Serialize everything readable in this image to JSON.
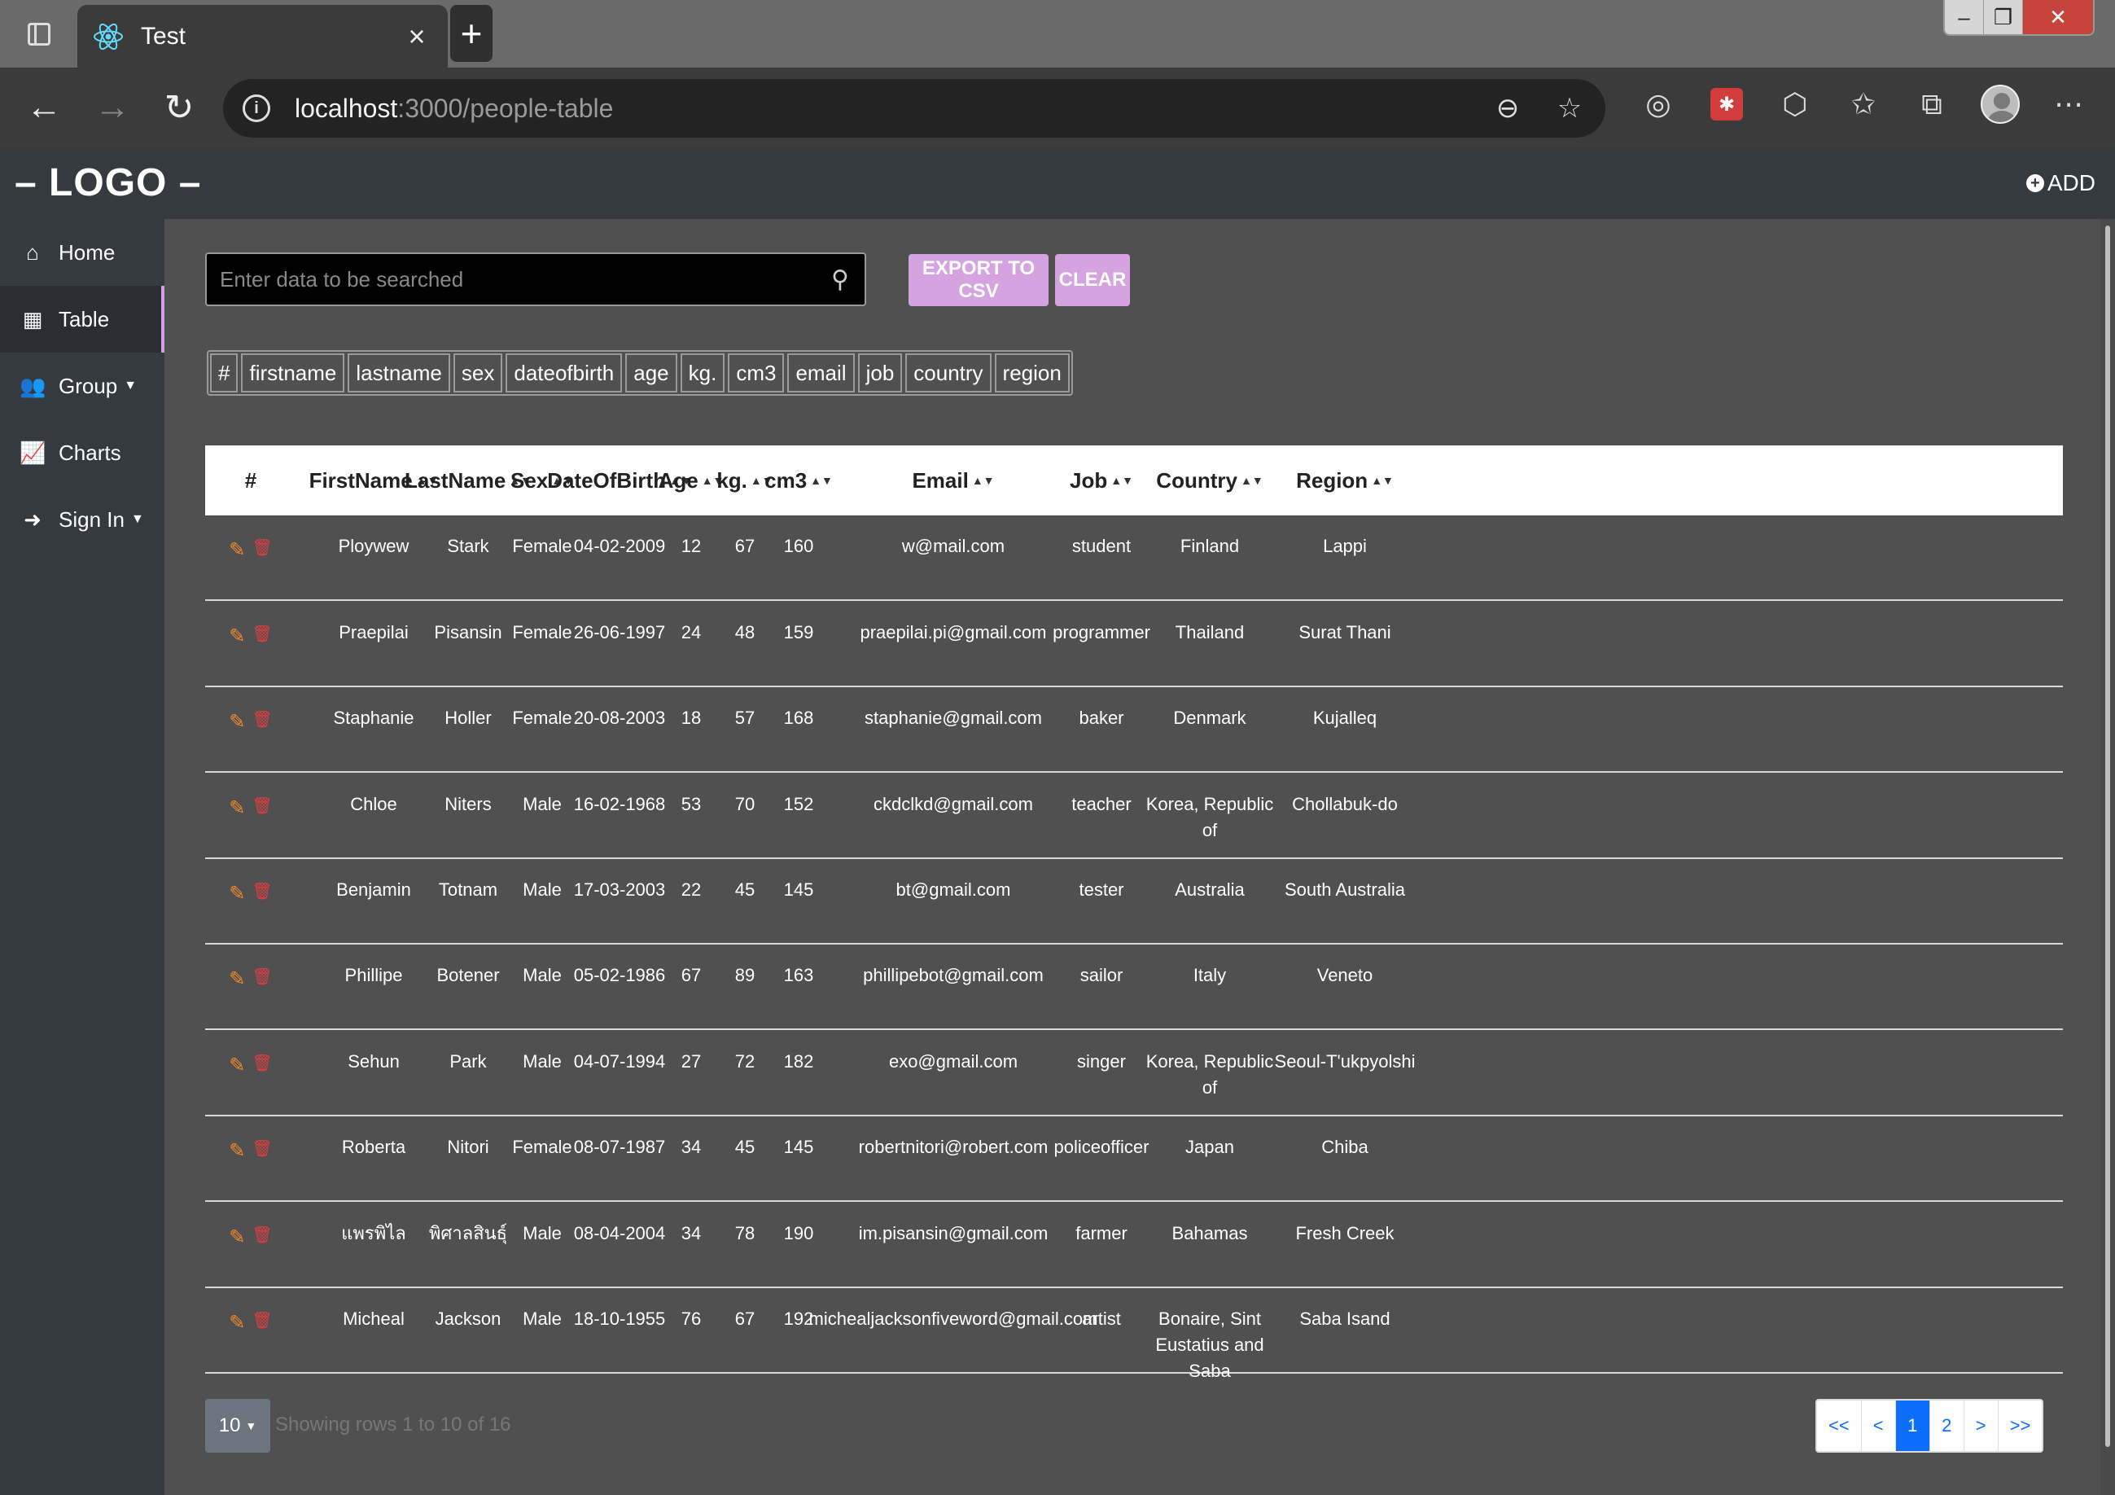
{
  "browser": {
    "tab_title": "Test",
    "new_tab_label": "+",
    "url_host": "localhost",
    "url_path": ":3000/people-table"
  },
  "app": {
    "logo": "– LOGO –",
    "add_label": "ADD"
  },
  "sidebar": {
    "items": [
      {
        "label": "Home",
        "icon": "home-icon"
      },
      {
        "label": "Table",
        "icon": "table-icon"
      },
      {
        "label": "Group",
        "icon": "users-icon"
      },
      {
        "label": "Charts",
        "icon": "chart-icon"
      },
      {
        "label": "Sign In",
        "icon": "sign-in-icon"
      }
    ]
  },
  "search": {
    "placeholder": "Enter data to be searched",
    "export_label": "EXPORT TO CSV",
    "clear_label": "CLEAR"
  },
  "column_toggles": [
    "#",
    "firstname",
    "lastname",
    "sex",
    "dateofbirth",
    "age",
    "kg.",
    "cm3",
    "email",
    "job",
    "country",
    "region"
  ],
  "table": {
    "headers": [
      "#",
      "FirstName",
      "LastName",
      "Sex",
      "DateOfBirth",
      "Age",
      "kg.",
      "cm3",
      "Email",
      "Job",
      "Country",
      "Region"
    ],
    "rows": [
      {
        "firstname": "Ploywew",
        "lastname": "Stark",
        "sex": "Female",
        "dob": "04-02-2009",
        "age": "12",
        "kg": "67",
        "cm3": "160",
        "email": "w@mail.com",
        "job": "student",
        "country": "Finland",
        "region": "Lappi"
      },
      {
        "firstname": "Praepilai",
        "lastname": "Pisansin",
        "sex": "Female",
        "dob": "26-06-1997",
        "age": "24",
        "kg": "48",
        "cm3": "159",
        "email": "praepilai.pi@gmail.com",
        "job": "programmer",
        "country": "Thailand",
        "region": "Surat Thani"
      },
      {
        "firstname": "Staphanie",
        "lastname": "Holler",
        "sex": "Female",
        "dob": "20-08-2003",
        "age": "18",
        "kg": "57",
        "cm3": "168",
        "email": "staphanie@gmail.com",
        "job": "baker",
        "country": "Denmark",
        "region": "Kujalleq"
      },
      {
        "firstname": "Chloe",
        "lastname": "Niters",
        "sex": "Male",
        "dob": "16-02-1968",
        "age": "53",
        "kg": "70",
        "cm3": "152",
        "email": "ckdclkd@gmail.com",
        "job": "teacher",
        "country": "Korea, Republic of",
        "region": "Chollabuk-do"
      },
      {
        "firstname": "Benjamin",
        "lastname": "Totnam",
        "sex": "Male",
        "dob": "17-03-2003",
        "age": "22",
        "kg": "45",
        "cm3": "145",
        "email": "bt@gmail.com",
        "job": "tester",
        "country": "Australia",
        "region": "South Australia"
      },
      {
        "firstname": "Phillipe",
        "lastname": "Botener",
        "sex": "Male",
        "dob": "05-02-1986",
        "age": "67",
        "kg": "89",
        "cm3": "163",
        "email": "phillipebot@gmail.com",
        "job": "sailor",
        "country": "Italy",
        "region": "Veneto"
      },
      {
        "firstname": "Sehun",
        "lastname": "Park",
        "sex": "Male",
        "dob": "04-07-1994",
        "age": "27",
        "kg": "72",
        "cm3": "182",
        "email": "exo@gmail.com",
        "job": "singer",
        "country": "Korea, Republic of",
        "region": "Seoul-T'ukpyolshi"
      },
      {
        "firstname": "Roberta",
        "lastname": "Nitori",
        "sex": "Female",
        "dob": "08-07-1987",
        "age": "34",
        "kg": "45",
        "cm3": "145",
        "email": "robertnitori@robert.com",
        "job": "policeofficer",
        "country": "Japan",
        "region": "Chiba"
      },
      {
        "firstname": "แพรพิไล",
        "lastname": "พิศาลสินธุ์",
        "sex": "Male",
        "dob": "08-04-2004",
        "age": "34",
        "kg": "78",
        "cm3": "190",
        "email": "im.pisansin@gmail.com",
        "job": "farmer",
        "country": "Bahamas",
        "region": "Fresh Creek"
      },
      {
        "firstname": "Micheal",
        "lastname": "Jackson",
        "sex": "Male",
        "dob": "18-10-1955",
        "age": "76",
        "kg": "67",
        "cm3": "192",
        "email": "michealjacksonfiveword@gmail.com",
        "job": "artist",
        "country": "Bonaire, Sint Eustatius and Saba",
        "region": "Saba Isand"
      }
    ]
  },
  "footer": {
    "page_size": "10",
    "showing": "Showing rows 1 to 10 of 16",
    "pages": [
      "<<",
      "<",
      "1",
      "2",
      ">",
      ">>"
    ],
    "active_page": "1"
  },
  "colors": {
    "accent": "#d4a3e0",
    "pager_active": "#0d6efd",
    "edit_icon": "#f08b2a",
    "delete_icon": "#e03d3d"
  }
}
